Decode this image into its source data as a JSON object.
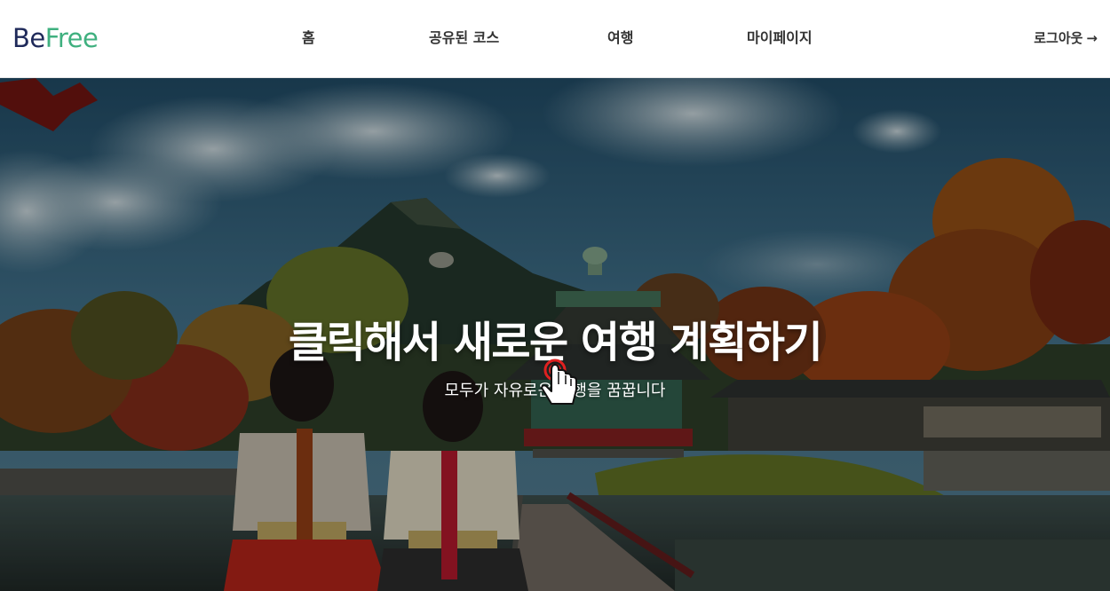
{
  "logo": {
    "part1": "Be",
    "part2": "Free"
  },
  "nav": {
    "items": [
      {
        "label": "홈"
      },
      {
        "label": "공유된 코스"
      },
      {
        "label": "여행"
      },
      {
        "label": "마이페이지"
      }
    ],
    "logout_label": "로그아웃",
    "logout_icon": "arrow-right-icon"
  },
  "hero": {
    "title": "클릭해서 새로운 여행 계획하기",
    "subtitle": "모두가 자유로운 여행을 꿈꿉니다",
    "cursor_icon": "hand-pointer-icon"
  },
  "colors": {
    "logo_dark": "#1f2a5a",
    "logo_green": "#3fb07f",
    "nav_text": "#333333",
    "click_ring": "#e02020"
  }
}
